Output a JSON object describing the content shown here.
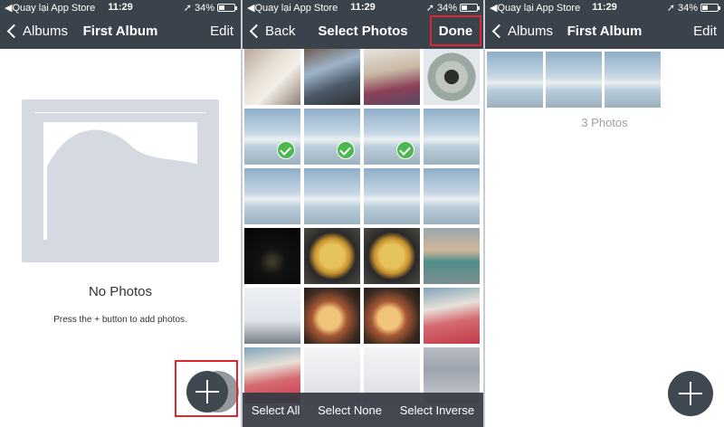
{
  "status_bar": {
    "back_app": "◀Quay lại App Store",
    "time": "11:29",
    "battery": "34%"
  },
  "panel1": {
    "back_label": "Albums",
    "title": "First Album",
    "right_label": "Edit",
    "empty_title": "No Photos",
    "empty_subtitle": "Press the + button to add photos."
  },
  "panel2": {
    "back_label": "Back",
    "title": "Select Photos",
    "done_label": "Done",
    "toolbar": {
      "select_all": "Select All",
      "select_none": "Select None",
      "select_inverse": "Select Inverse"
    },
    "photos": [
      {
        "name": "cup-photo",
        "selected": false
      },
      {
        "name": "desk-laptop-photo",
        "selected": false
      },
      {
        "name": "interior-room-photo",
        "selected": false
      },
      {
        "name": "fisheye-photo",
        "selected": false
      },
      {
        "name": "beach-photo",
        "selected": true
      },
      {
        "name": "beach-photo",
        "selected": true
      },
      {
        "name": "beach-photo",
        "selected": true
      },
      {
        "name": "beach-photo",
        "selected": false
      },
      {
        "name": "beach-photo",
        "selected": false
      },
      {
        "name": "beach-photo",
        "selected": false
      },
      {
        "name": "beach-photo",
        "selected": false
      },
      {
        "name": "beach-photo",
        "selected": false
      },
      {
        "name": "night-photo",
        "selected": false
      },
      {
        "name": "omelette-photo",
        "selected": false
      },
      {
        "name": "omelette-photo",
        "selected": false
      },
      {
        "name": "building-photo",
        "selected": false
      },
      {
        "name": "screen-photo",
        "selected": false
      },
      {
        "name": "food-table-photo",
        "selected": false
      },
      {
        "name": "food-table-photo",
        "selected": false
      },
      {
        "name": "toys-photo",
        "selected": false
      },
      {
        "name": "toys-photo",
        "selected": false
      },
      {
        "name": "settings-screenshot",
        "selected": false
      },
      {
        "name": "settings-screenshot",
        "selected": false
      },
      {
        "name": "control-center-screenshot",
        "selected": false
      }
    ]
  },
  "panel3": {
    "back_label": "Albums",
    "title": "First Album",
    "right_label": "Edit",
    "photo_count": "3 Photos"
  },
  "colors": {
    "navbar": "#3a434c",
    "highlight": "#e0262c",
    "check": "#4cb84f"
  },
  "icons": {
    "back": "chevron-left-icon",
    "add": "plus-icon",
    "location": "location-arrow-icon",
    "battery": "battery-icon",
    "check": "checkmark-icon"
  }
}
